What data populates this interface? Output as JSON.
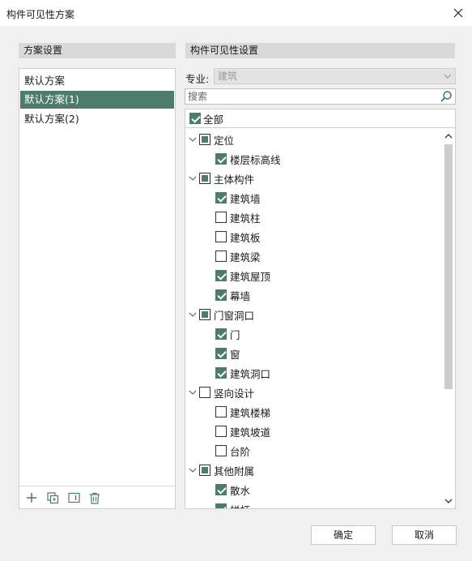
{
  "window": {
    "title": "构件可见性方案"
  },
  "scheme_settings": {
    "header": "方案设置",
    "items": [
      {
        "label": "默认方案",
        "selected": false
      },
      {
        "label": "默认方案(1)",
        "selected": true
      },
      {
        "label": "默认方案(2)",
        "selected": false
      }
    ],
    "toolbar_icons": [
      "add-icon",
      "duplicate-icon",
      "rename-icon",
      "delete-icon"
    ]
  },
  "visibility": {
    "header": "构件可见性设置",
    "discipline_label": "专业:",
    "discipline_value": "建筑",
    "search_placeholder": "搜索",
    "all_label": "全部",
    "all_checked": true,
    "groups": [
      {
        "label": "定位",
        "state": "partial",
        "children": [
          {
            "label": "楼层标高线",
            "checked": true
          }
        ]
      },
      {
        "label": "主体构件",
        "state": "partial",
        "children": [
          {
            "label": "建筑墙",
            "checked": true
          },
          {
            "label": "建筑柱",
            "checked": false
          },
          {
            "label": "建筑板",
            "checked": false
          },
          {
            "label": "建筑梁",
            "checked": false
          },
          {
            "label": "建筑屋顶",
            "checked": true
          },
          {
            "label": "幕墙",
            "checked": true
          }
        ]
      },
      {
        "label": "门窗洞口",
        "state": "partial",
        "children": [
          {
            "label": "门",
            "checked": true
          },
          {
            "label": "窗",
            "checked": true
          },
          {
            "label": "建筑洞口",
            "checked": true
          }
        ]
      },
      {
        "label": "竖向设计",
        "state": "unchecked",
        "children": [
          {
            "label": "建筑楼梯",
            "checked": false
          },
          {
            "label": "建筑坡道",
            "checked": false
          },
          {
            "label": "台阶",
            "checked": false
          }
        ]
      },
      {
        "label": "其他附属",
        "state": "partial",
        "children": [
          {
            "label": "散水",
            "checked": true
          },
          {
            "label": "栏杆",
            "checked": true
          }
        ]
      }
    ]
  },
  "buttons": {
    "ok": "确定",
    "cancel": "取消"
  },
  "colors": {
    "accent": "#4d7c6b",
    "background": "#f0f0f0"
  }
}
